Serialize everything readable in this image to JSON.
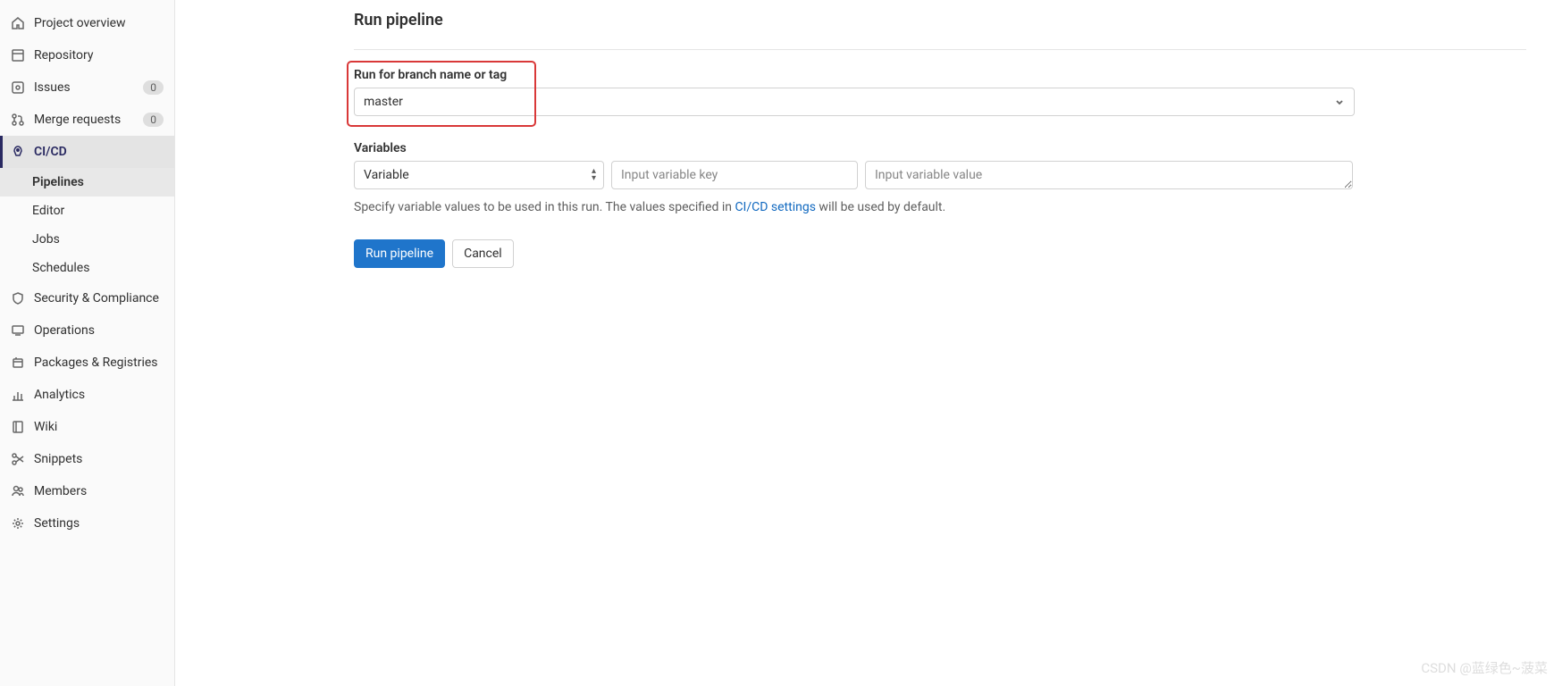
{
  "sidebar": {
    "items": [
      {
        "label": "Project overview",
        "icon": "home-icon"
      },
      {
        "label": "Repository",
        "icon": "repository-icon"
      },
      {
        "label": "Issues",
        "icon": "issues-icon",
        "badge": "0"
      },
      {
        "label": "Merge requests",
        "icon": "merge-request-icon",
        "badge": "0"
      },
      {
        "label": "CI/CD",
        "icon": "rocket-icon",
        "active": true
      },
      {
        "label": "Security & Compliance",
        "icon": "shield-icon"
      },
      {
        "label": "Operations",
        "icon": "operations-icon"
      },
      {
        "label": "Packages & Registries",
        "icon": "package-icon"
      },
      {
        "label": "Analytics",
        "icon": "analytics-icon"
      },
      {
        "label": "Wiki",
        "icon": "book-icon"
      },
      {
        "label": "Snippets",
        "icon": "scissors-icon"
      },
      {
        "label": "Members",
        "icon": "members-icon"
      },
      {
        "label": "Settings",
        "icon": "gear-icon"
      }
    ],
    "cicd_subitems": [
      {
        "label": "Pipelines",
        "active": true
      },
      {
        "label": "Editor"
      },
      {
        "label": "Jobs"
      },
      {
        "label": "Schedules"
      }
    ]
  },
  "main": {
    "title": "Run pipeline",
    "branch_label": "Run for branch name or tag",
    "branch_value": "master",
    "variables_label": "Variables",
    "var_type_value": "Variable",
    "var_key_placeholder": "Input variable key",
    "var_value_placeholder": "Input variable value",
    "help_text_pre": "Specify variable values to be used in this run. The values specified in ",
    "help_link_text": "CI/CD settings",
    "help_text_post": " will be used by default.",
    "run_button": "Run pipeline",
    "cancel_button": "Cancel"
  },
  "watermark": "CSDN @蓝绿色~菠菜"
}
